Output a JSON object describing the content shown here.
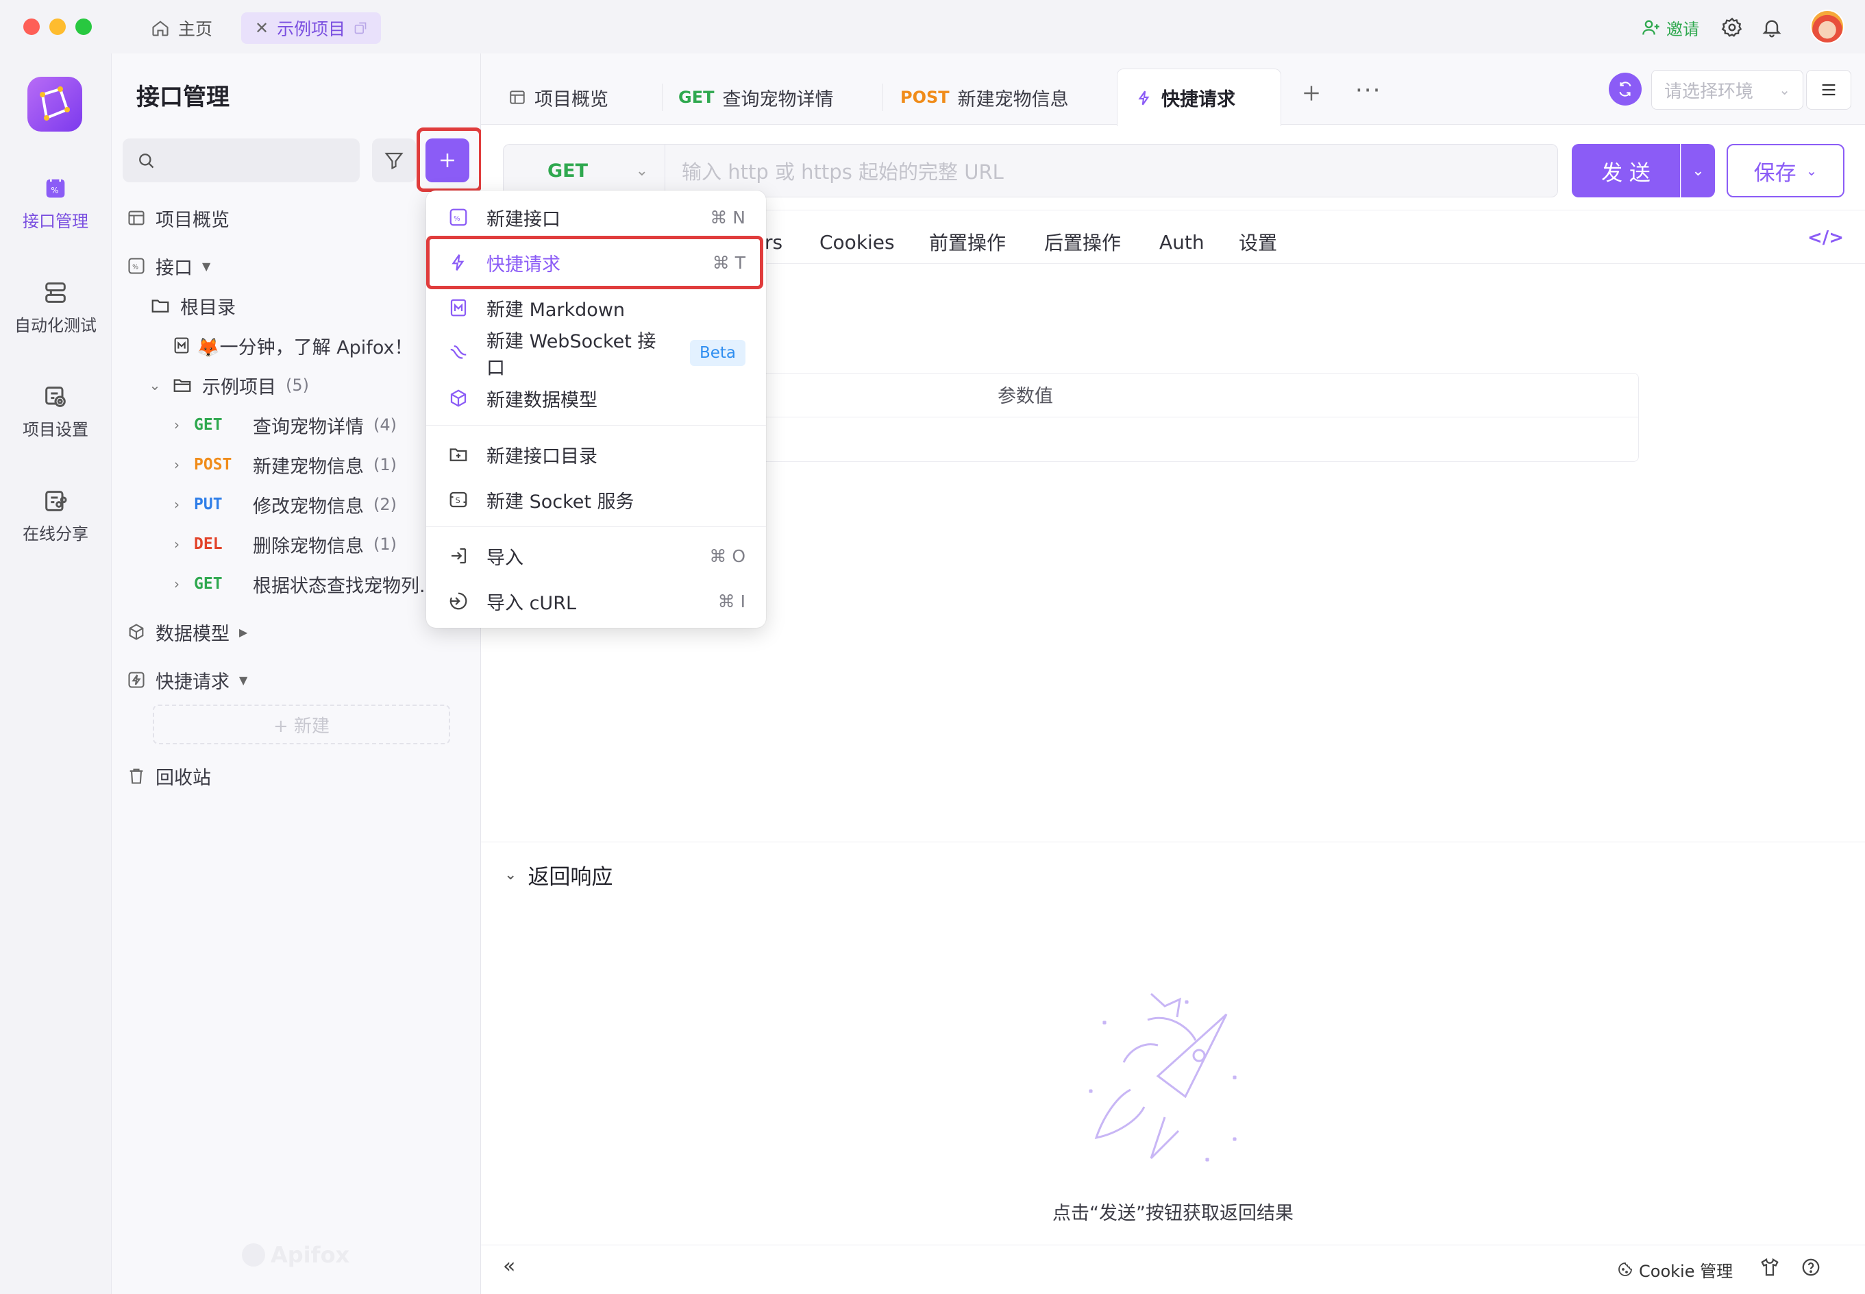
{
  "titlebar": {
    "home_tab": "主页",
    "project_tab": "示例项目",
    "invite": "邀请"
  },
  "rail": {
    "items": [
      {
        "label": "接口管理"
      },
      {
        "label": "自动化测试"
      },
      {
        "label": "项目设置"
      },
      {
        "label": "在线分享"
      }
    ]
  },
  "sidebar": {
    "title": "接口管理",
    "search_placeholder": "",
    "overview": "项目概览",
    "api_group": "接口",
    "root": "根目录",
    "intro_doc": "🦊一分钟，了解 Apifox！",
    "folder": {
      "name": "示例项目",
      "count": "(5)"
    },
    "endpoints": [
      {
        "method": "GET",
        "name": "查询宠物详情",
        "count": "(4)"
      },
      {
        "method": "POST",
        "name": "新建宠物信息",
        "count": "(1)"
      },
      {
        "method": "PUT",
        "name": "修改宠物信息",
        "count": "(2)"
      },
      {
        "method": "DEL",
        "name": "删除宠物信息",
        "count": "(1)"
      },
      {
        "method": "GET",
        "name": "根据状态查找宠物列..."
      }
    ],
    "data_models": "数据模型",
    "quick_requests": "快捷请求",
    "new_btn": "+ 新建",
    "trash": "回收站",
    "watermark": "Apifox"
  },
  "main": {
    "tabs": [
      {
        "label": "项目概览"
      },
      {
        "method": "GET",
        "label": "查询宠物详情"
      },
      {
        "method": "POST",
        "label": "新建宠物信息"
      },
      {
        "label": "快捷请求"
      }
    ],
    "env_placeholder": "请选择环境",
    "request": {
      "method": "GET",
      "url_placeholder": "输入 http 或 https 起始的完整 URL",
      "send": "发 送",
      "save": "保存"
    },
    "subtabs": [
      "rs",
      "Cookies",
      "前置操作",
      "后置操作",
      "Auth",
      "设置"
    ],
    "param_value_header": "参数值",
    "response": {
      "title": "返回响应",
      "empty_hint": "点击“发送”按钮获取返回结果"
    },
    "footer": {
      "cookie": "Cookie 管理"
    }
  },
  "menu": {
    "items": [
      {
        "label": "新建接口",
        "shortcut": "⌘ N"
      },
      {
        "label": "快捷请求",
        "shortcut": "⌘ T"
      },
      {
        "label": "新建 Markdown"
      },
      {
        "label": "新建 WebSocket 接口",
        "badge": "Beta"
      },
      {
        "label": "新建数据模型"
      },
      {
        "label": "新建接口目录"
      },
      {
        "label": "新建 Socket 服务"
      },
      {
        "label": "导入",
        "shortcut": "⌘ O"
      },
      {
        "label": "导入 cURL",
        "shortcut": "⌘ I"
      }
    ]
  },
  "colors": {
    "accent": "#8b5cf6",
    "get": "#2fa84f",
    "post": "#f08c1a",
    "put": "#2f7ee8",
    "del": "#e2432a",
    "highlight": "#e03c3c"
  }
}
